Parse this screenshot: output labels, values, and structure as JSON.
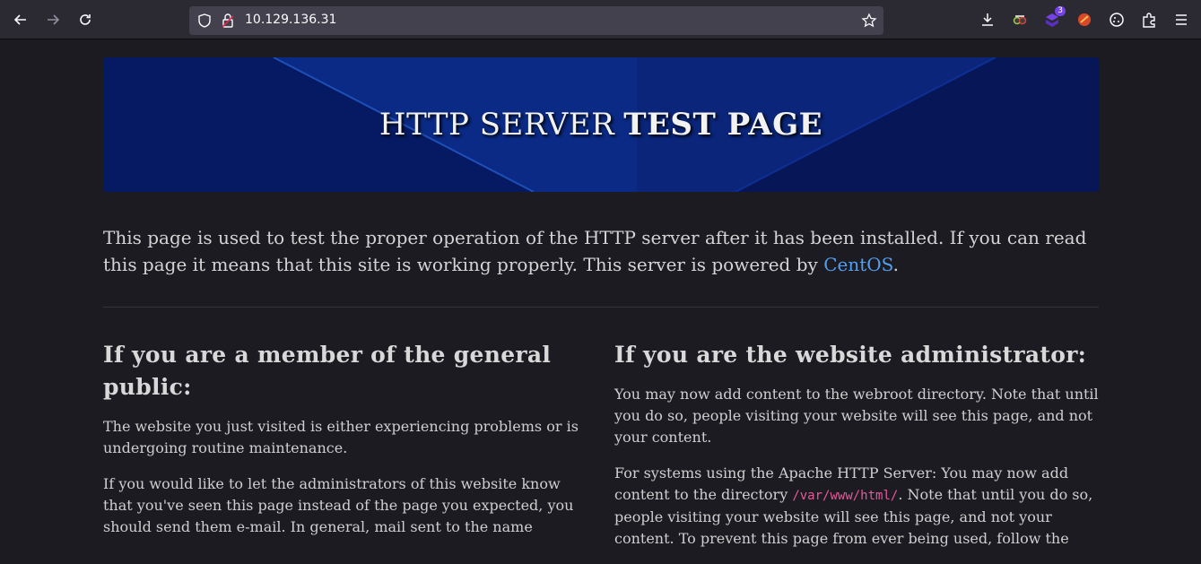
{
  "browser": {
    "url": "10.129.136.31",
    "extension_badge_count": "3",
    "icons": [
      "back-icon",
      "forward-icon",
      "reload-icon",
      "shield-icon",
      "lock-icon",
      "star-icon",
      "download-icon",
      "extension-icon",
      "puzzle-icon",
      "menu-icon"
    ]
  },
  "banner": {
    "title_light": "HTTP SERVER",
    "title_bold": "TEST PAGE"
  },
  "intro": {
    "text_before_link": "This page is used to test the proper operation of the HTTP server after it has been installed. If you can read this page it means that this site is working properly. This server is powered by ",
    "link": "CentOS",
    "text_after_link": "."
  },
  "public": {
    "heading": "If you are a member of the general public:",
    "p1": "The website you just visited is either experiencing problems or is undergoing routine maintenance.",
    "p2": "If you would like to let the administrators of this website know that you've seen this page instead of the page you expected, you should send them e-mail. In general, mail sent to the name"
  },
  "admin": {
    "heading": "If you are the website administrator:",
    "p1": "You may now add content to the webroot directory. Note that until you do so, people visiting your website will see this page, and not your content.",
    "p2_before_code": "For systems using the Apache HTTP Server: You may now add content to the directory ",
    "p2_code": "/var/www/html/",
    "p2_after_code": ". Note that until you do so, people visiting your website will see this page, and not your content. To prevent this page from ever being used, follow the"
  }
}
